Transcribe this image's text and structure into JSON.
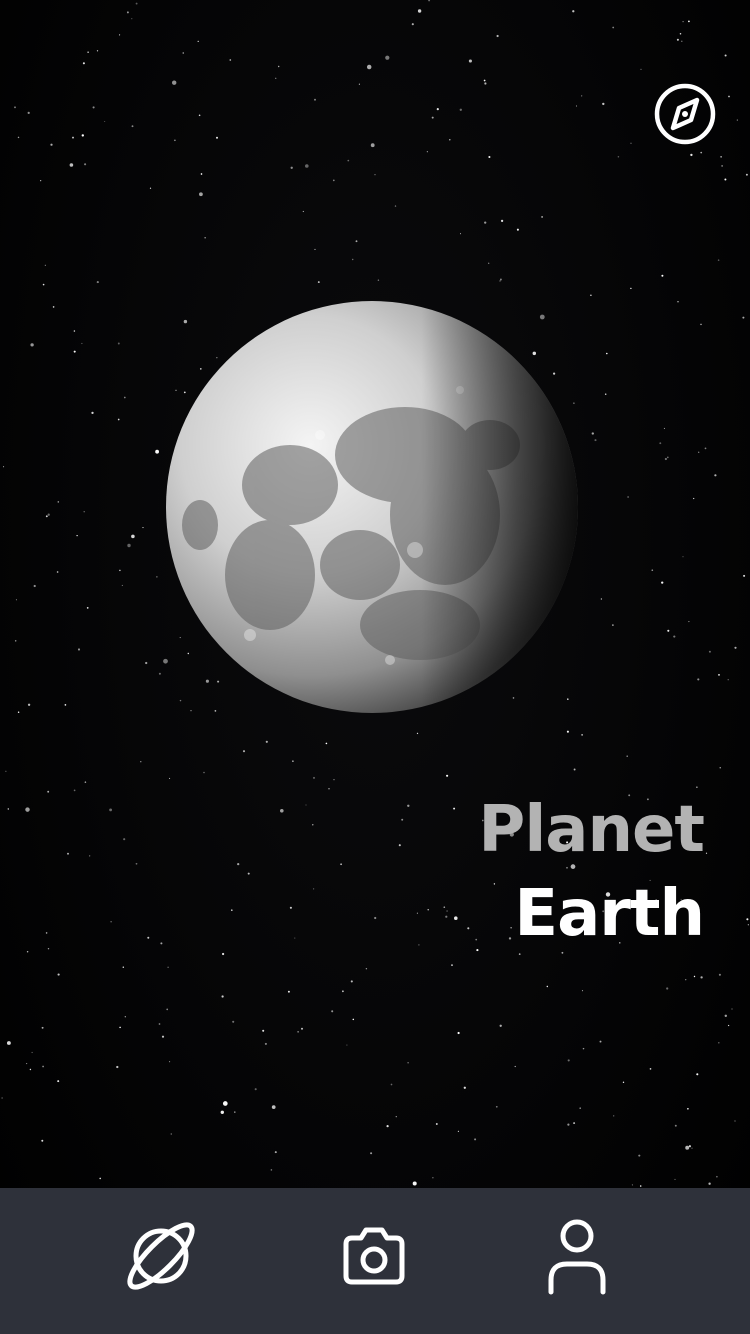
{
  "title": {
    "line1": "Planet",
    "line2": "Earth"
  },
  "header": {
    "compass_icon": "compass-icon"
  },
  "tabbar": {
    "items": [
      {
        "icon": "planet-icon"
      },
      {
        "icon": "camera-icon"
      },
      {
        "icon": "profile-icon"
      }
    ]
  },
  "colors": {
    "background": "#000000",
    "tabbar": "#2e313a",
    "title_line1": "#b3b3b3",
    "title_line2": "#ffffff",
    "icon": "#ffffff"
  }
}
